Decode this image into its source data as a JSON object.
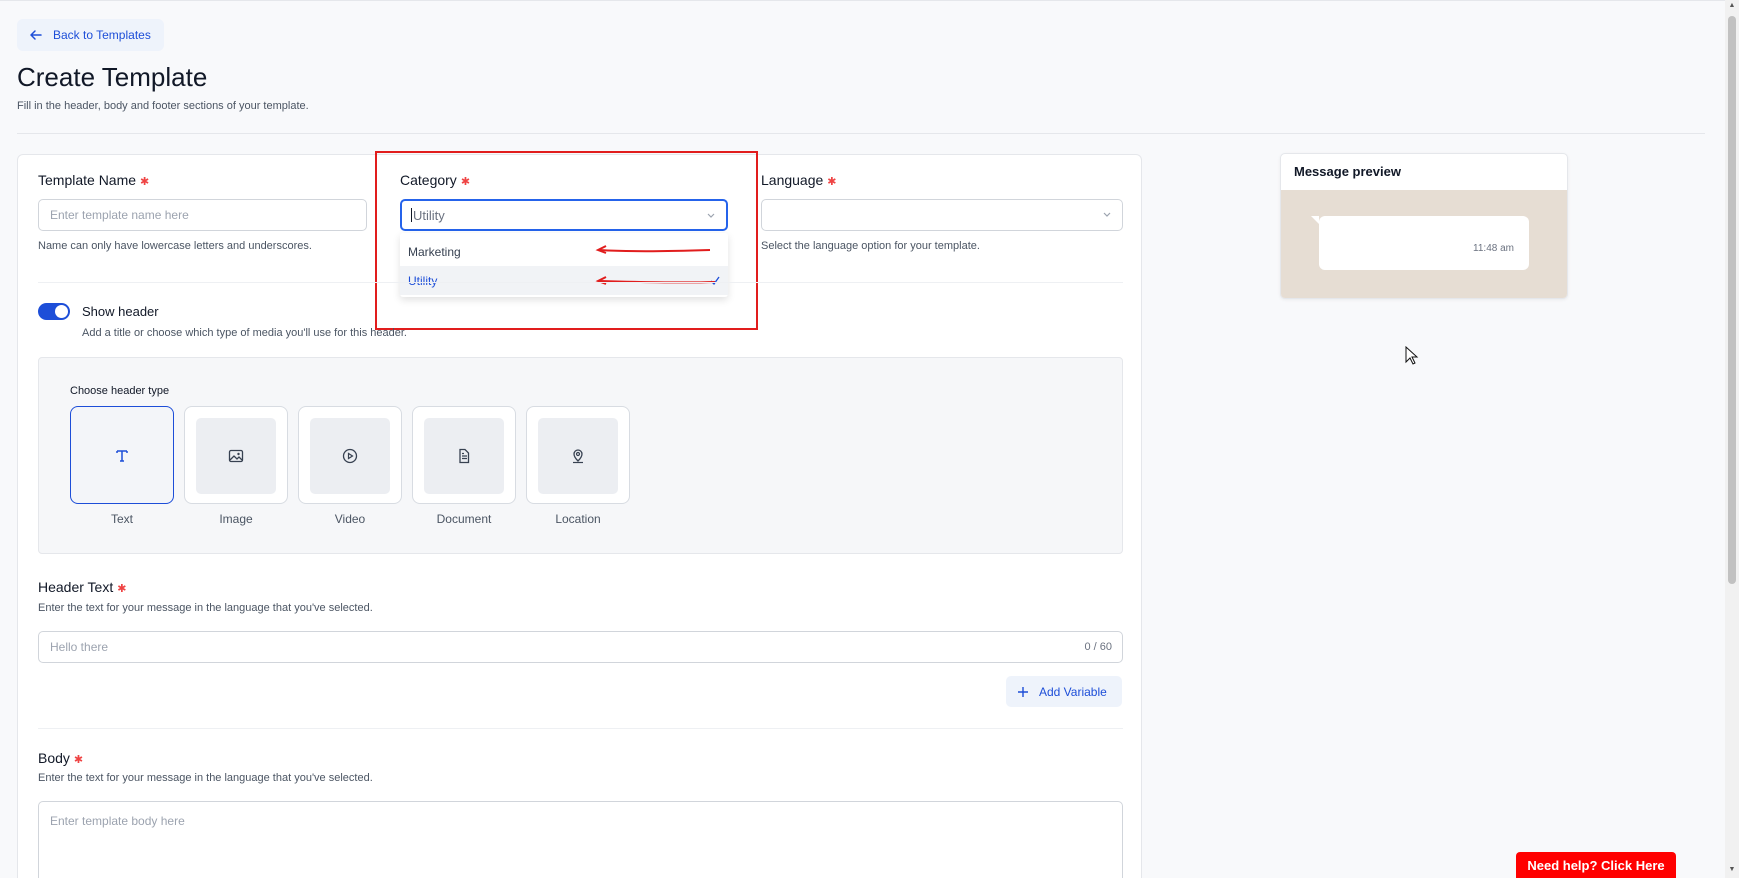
{
  "nav": {
    "back_label": "Back to Templates"
  },
  "page": {
    "title": "Create Template",
    "subtitle": "Fill in the header, body and footer sections of your template."
  },
  "template_name": {
    "label": "Template Name",
    "placeholder": "Enter template name here",
    "hint": "Name can only have lowercase letters and underscores."
  },
  "category": {
    "label": "Category",
    "value": "Utility",
    "options": [
      "Marketing",
      "Utility"
    ],
    "selected": "Utility"
  },
  "language": {
    "label": "Language",
    "value": "",
    "hint": "Select the language option for your template."
  },
  "header": {
    "toggle_label": "Show header",
    "toggle_on": true,
    "toggle_hint": "Add a title or choose which type of media you'll use for this header.",
    "choose_label": "Choose header type",
    "types": [
      {
        "label": "Text",
        "icon": "text-t-icon"
      },
      {
        "label": "Image",
        "icon": "image-icon"
      },
      {
        "label": "Video",
        "icon": "play-icon"
      },
      {
        "label": "Document",
        "icon": "document-icon"
      },
      {
        "label": "Location",
        "icon": "location-pin-icon"
      }
    ],
    "selected_type": "Text",
    "text_label": "Header Text",
    "text_hint": "Enter the text for your message in the language that you've selected.",
    "text_placeholder": "Hello there",
    "char_count": "0 / 60",
    "add_variable_label": "Add Variable"
  },
  "body": {
    "label": "Body",
    "hint": "Enter the text for your message in the language that you've selected.",
    "placeholder": "Enter template body here"
  },
  "preview": {
    "title": "Message preview",
    "time": "11:48 am"
  },
  "help": {
    "label": "Need help? Click Here"
  },
  "colors": {
    "accent": "#1d4ed8",
    "required": "#ef4444",
    "annotation_red": "#e11d1d",
    "help_red": "#ff0000"
  }
}
